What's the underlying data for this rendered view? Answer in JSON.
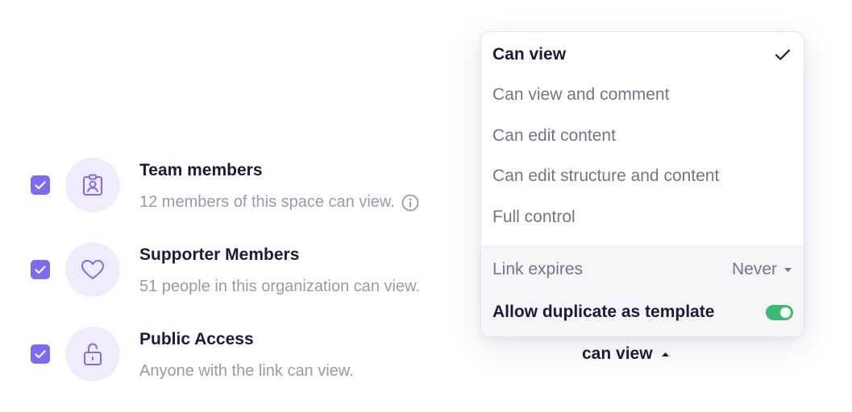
{
  "rows": [
    {
      "title": "Team members",
      "description": "12 members of this space can view.",
      "icon": "id-badge-icon",
      "checked": true,
      "has_info_icon": true
    },
    {
      "title": "Supporter Members",
      "description": "51 people in this organization can view.",
      "icon": "heart-icon",
      "checked": true,
      "has_info_icon": false
    },
    {
      "title": "Public Access",
      "description": "Anyone with the link can view.",
      "icon": "lock-open-icon",
      "checked": true,
      "has_info_icon": false
    }
  ],
  "dropdown": {
    "options": [
      "Can view",
      "Can view and comment",
      "Can edit content",
      "Can edit structure and content",
      "Full control"
    ],
    "selected_index": 0,
    "link_expires": {
      "label": "Link expires",
      "value": "Never"
    },
    "allow_duplicate": {
      "label": "Allow duplicate as template",
      "enabled": true
    }
  },
  "trigger": {
    "label": "can view"
  },
  "colors": {
    "accent": "#7b6cf0",
    "accent_soft": "#efedfd",
    "text_dark": "#1d1a3d",
    "text_muted": "#9b99a8",
    "toggle_on": "#3fb872"
  }
}
